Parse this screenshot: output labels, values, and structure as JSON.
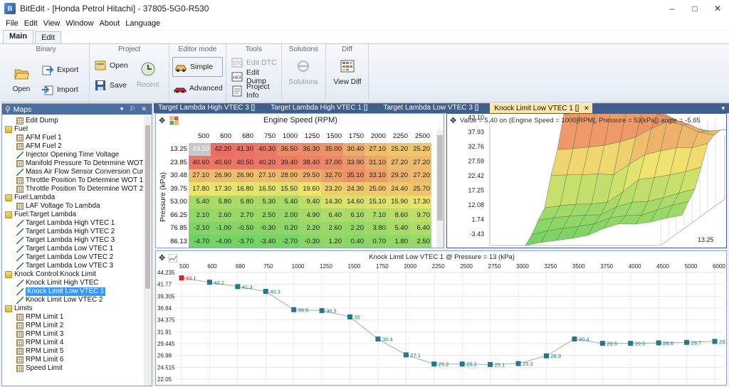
{
  "window": {
    "title": "BitEdit - [Honda Petrol Hitachi] - 37805-5G0-R530",
    "app_icon": "app-icon",
    "controls": [
      "–",
      "□",
      "✕"
    ]
  },
  "menu": [
    "File",
    "Edit",
    "View",
    "Window",
    "About",
    "Language"
  ],
  "ribbon_tabs": [
    "Main",
    "Edit"
  ],
  "ribbon": {
    "binary": {
      "title": "Binary",
      "open": "Open",
      "export": "Export",
      "import": "Import"
    },
    "project": {
      "title": "Project",
      "open": "Open",
      "save": "Save",
      "recent": "Recent"
    },
    "editor_mode": {
      "title": "Editor mode",
      "simple": "Simple",
      "advanced": "Advanced"
    },
    "tools": {
      "title": "Tools",
      "edit_dtc": "Edit DTC",
      "edit_dump": "Edit Dump",
      "project_info": "Project Info"
    },
    "solutions": {
      "title": "Solutions",
      "solutions": "Solutions"
    },
    "diff": {
      "title": "Diff",
      "view_diff": "View Diff"
    }
  },
  "maps_panel": {
    "title": "Maps",
    "controls": "▾ ⚐ ✕",
    "items": [
      {
        "label": "Edit Dump",
        "kind": "map",
        "depth": 1
      },
      {
        "label": "Fuel",
        "kind": "folder",
        "depth": 0
      },
      {
        "label": "AFM Fuel 1",
        "kind": "map",
        "depth": 1
      },
      {
        "label": "AFM Fuel 2",
        "kind": "map",
        "depth": 1
      },
      {
        "label": "Injector Opening Time Voltage",
        "kind": "line",
        "depth": 1
      },
      {
        "label": "Manifold Pressure To Determine WOT 3",
        "kind": "map",
        "depth": 1
      },
      {
        "label": "Mass Air Flow Sensor Conversion Curve",
        "kind": "line",
        "depth": 1
      },
      {
        "label": "Throttle Position To Determine WOT 1",
        "kind": "map",
        "depth": 1
      },
      {
        "label": "Throttle Position To Determine WOT 2",
        "kind": "map",
        "depth": 1
      },
      {
        "label": "Fuel:Lambda",
        "kind": "folder",
        "depth": 0
      },
      {
        "label": "LAF Voltage To Lambda",
        "kind": "map",
        "depth": 1
      },
      {
        "label": "Fuel:Target Lambda",
        "kind": "folder",
        "depth": 0
      },
      {
        "label": "Target Lambda High VTEC 1",
        "kind": "line",
        "depth": 1
      },
      {
        "label": "Target Lambda High VTEC 2",
        "kind": "line",
        "depth": 1
      },
      {
        "label": "Target Lambda High VTEC 3",
        "kind": "line",
        "depth": 1
      },
      {
        "label": "Target Lambda Low VTEC 1",
        "kind": "line",
        "depth": 1
      },
      {
        "label": "Target Lambda Low VTEC 2",
        "kind": "line",
        "depth": 1
      },
      {
        "label": "Target Lambda Low VTEC 3",
        "kind": "line",
        "depth": 1
      },
      {
        "label": "Knock Control:Knock Limit",
        "kind": "folder",
        "depth": 0
      },
      {
        "label": "Knock Limit High VTEC",
        "kind": "line",
        "depth": 1
      },
      {
        "label": "Knock Limit Low VTEC 1",
        "kind": "line",
        "depth": 1,
        "selected": true
      },
      {
        "label": "Knock Limit Low VTEC 2",
        "kind": "line",
        "depth": 1
      },
      {
        "label": "Limits",
        "kind": "folder",
        "depth": 0
      },
      {
        "label": "RPM Limit 1",
        "kind": "map",
        "depth": 1
      },
      {
        "label": "RPM Limit 2",
        "kind": "map",
        "depth": 1
      },
      {
        "label": "RPM Limit 3",
        "kind": "map",
        "depth": 1
      },
      {
        "label": "RPM Limit 4",
        "kind": "map",
        "depth": 1
      },
      {
        "label": "RPM Limit 5",
        "kind": "map",
        "depth": 1
      },
      {
        "label": "RPM Limit 6",
        "kind": "map",
        "depth": 1
      },
      {
        "label": "Speed Limit",
        "kind": "map",
        "depth": 1
      }
    ]
  },
  "doc_tabs": [
    {
      "label": "Target Lambda High VTEC 3 []",
      "active": false
    },
    {
      "label": "Target Lambda High VTEC 1 []",
      "active": false
    },
    {
      "label": "Target Lambda Low VTEC 3 []",
      "active": false
    },
    {
      "label": "Knock Limit Low VTEC 1 []",
      "active": true
    }
  ],
  "doc_tab_close": "✕",
  "doc_tab_menu": "▾",
  "grid": {
    "title": "Engine Speed (RPM)",
    "ylabel": "Pressure (kPa)",
    "columns": [
      "500",
      "600",
      "680",
      "750",
      "1000",
      "1250",
      "1500",
      "1750",
      "2000",
      "2250",
      "2500"
    ],
    "rows": [
      {
        "label": "13.25",
        "values": [
          "43.10",
          "42.20",
          "41.30",
          "40.30",
          "36.50",
          "36.30",
          "35.00",
          "30.40",
          "27.10",
          "25.20",
          "25.20"
        ]
      },
      {
        "label": "23.85",
        "values": [
          "40.60",
          "40.60",
          "40.50",
          "40.20",
          "39.40",
          "38.40",
          "37.00",
          "33.90",
          "31.10",
          "27.20",
          "27.20"
        ]
      },
      {
        "label": "30.48",
        "values": [
          "27.10",
          "26.90",
          "26.90",
          "27.10",
          "28.00",
          "29.50",
          "32.70",
          "35.10",
          "33.10",
          "29.20",
          "27.20"
        ]
      },
      {
        "label": "39.75",
        "values": [
          "17.80",
          "17.30",
          "16.80",
          "16.50",
          "15.50",
          "19.60",
          "23.20",
          "24.30",
          "25.00",
          "24.40",
          "25.70"
        ]
      },
      {
        "label": "53.00",
        "values": [
          "5.40",
          "5.80",
          "5.80",
          "5.30",
          "5.40",
          "9.40",
          "14.30",
          "14.60",
          "15.10",
          "15.90",
          "17.30"
        ]
      },
      {
        "label": "66.25",
        "values": [
          "2.10",
          "2.60",
          "2.70",
          "2.50",
          "2.00",
          "4.90",
          "6.40",
          "6.10",
          "7.10",
          "8.60",
          "9.70"
        ]
      },
      {
        "label": "76.85",
        "values": [
          "-2.10",
          "-1.00",
          "-0.50",
          "-0.30",
          "0.20",
          "2.20",
          "2.60",
          "2.20",
          "3.80",
          "5.40",
          "6.40"
        ]
      },
      {
        "label": "86.13",
        "values": [
          "-4.70",
          "-4.00",
          "-3.70",
          "-3.40",
          "-2.70",
          "-0.30",
          "1.20",
          "0.40",
          "0.70",
          "1.80",
          "2.50"
        ]
      }
    ]
  },
  "surface": {
    "info": "Value = 5.40  on (Engine Speed = 1000[RPM], Pressure = 53[kPa]) angle = -5.65",
    "z_ticks": [
      "43.10",
      "37.93",
      "32.76",
      "27.59",
      "22.42",
      "17.25",
      "12.08",
      "1.74",
      "-3.43"
    ],
    "x_tick": "13.25"
  },
  "chart_data": {
    "type": "line",
    "title": "Knock Limit Low VTEC 1 @ Pressure = 13 (kPa)",
    "x": [
      "500",
      "600",
      "680",
      "750",
      "1000",
      "1250",
      "1500",
      "1750",
      "2000",
      "2250",
      "2500",
      "2750",
      "3000",
      "3250",
      "3500",
      "3750",
      "4000",
      "4500",
      "5000",
      "6000"
    ],
    "values": [
      43.1,
      42.2,
      41.3,
      40.3,
      36.5,
      36.3,
      35.0,
      30.4,
      27.1,
      25.2,
      25.2,
      25.1,
      25.3,
      26.9,
      30.4,
      29.5,
      29.5,
      29.6,
      29.7,
      29.9
    ],
    "y_ticks": [
      "44.235",
      "41.77",
      "39.305",
      "36.84",
      "34.375",
      "31.91",
      "29.445",
      "26.98",
      "24.515",
      "22.05"
    ],
    "ylim": [
      22.05,
      44.235
    ],
    "highlight_index": 0,
    "colors": {
      "line": "#9ab89a",
      "point": "#1f7a8c",
      "highlight": "#e02020",
      "label": "#1f6f7f"
    }
  }
}
